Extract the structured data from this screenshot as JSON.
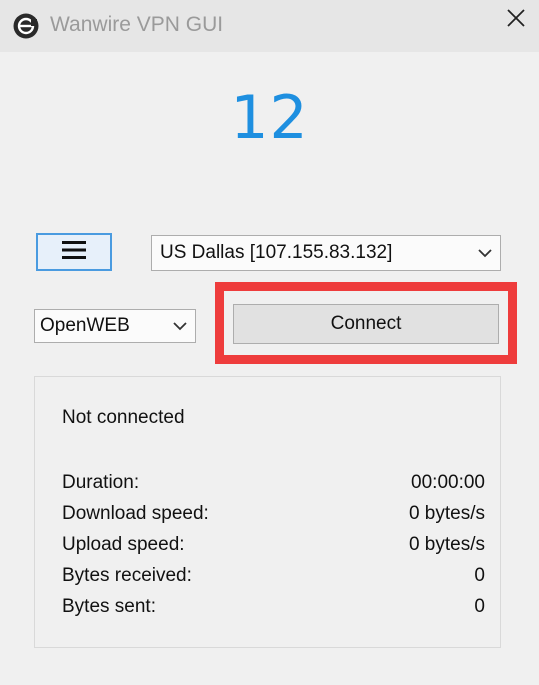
{
  "window": {
    "title": "Wanwire VPN GUI",
    "icons": {
      "app": "wanwire-logo-icon",
      "close": "close-icon"
    }
  },
  "logo": {
    "number": "12"
  },
  "controls": {
    "menu_icon": "hamburger-menu-icon",
    "server_selected": "US Dallas [107.155.83.132]",
    "protocol_selected": "OpenWEB",
    "connect_label": "Connect"
  },
  "status": {
    "message": "Not connected",
    "stats": [
      {
        "label": "Duration:",
        "value": "00:00:00"
      },
      {
        "label": "Download speed:",
        "value": "0 bytes/s"
      },
      {
        "label": "Upload speed:",
        "value": "0 bytes/s"
      },
      {
        "label": "Bytes received:",
        "value": "0"
      },
      {
        "label": "Bytes sent:",
        "value": "0"
      }
    ]
  },
  "colors": {
    "accent_blue": "#1e8fe0",
    "highlight_red": "#ee3c3c",
    "titlebar": "#e6e6e6",
    "window_bg": "#f0f0f0"
  }
}
